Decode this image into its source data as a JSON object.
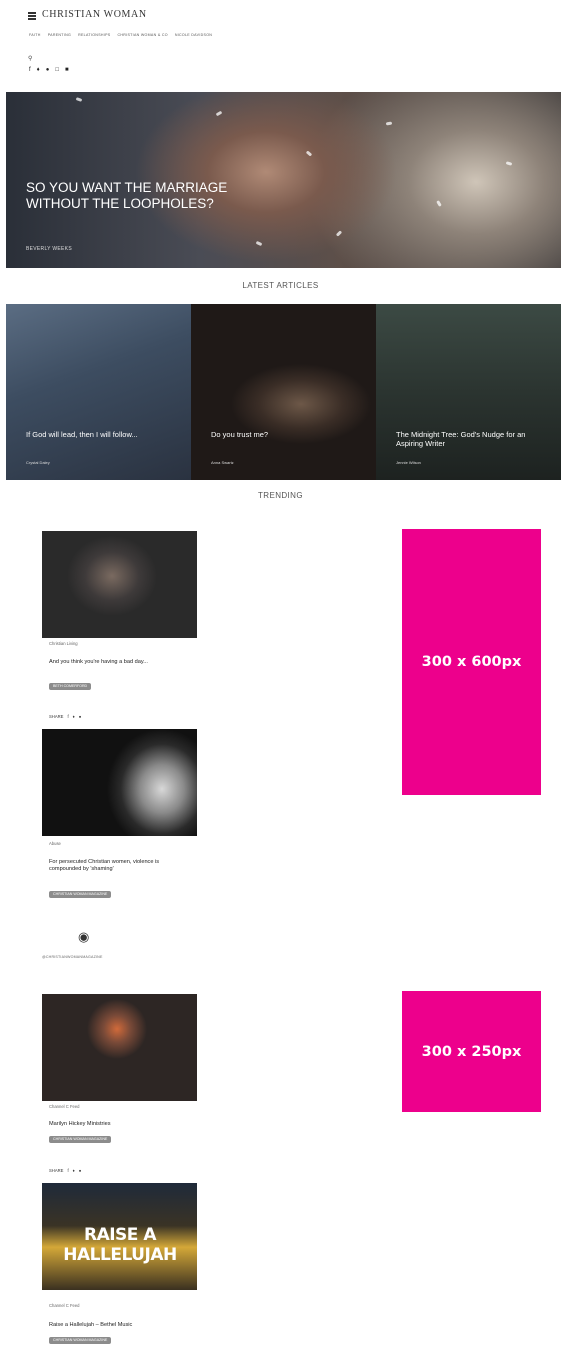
{
  "header": {
    "logo": "CHRISTIAN WOMAN",
    "nav": [
      "FAITH",
      "PARENTING",
      "RELATIONSHIPS",
      "CHRISTIAN WOMAN & CO",
      "NICOLE DAVIDSON"
    ],
    "social_icons": [
      "facebook-icon",
      "twitter-icon",
      "pinterest-icon",
      "instagram-icon",
      "email-icon"
    ]
  },
  "hero": {
    "title": "SO YOU WANT THE MARRIAGE WITHOUT THE LOOPHOLES?",
    "author": "BEVERLY WEEKS"
  },
  "latest": {
    "heading": "LATEST ARTICLES",
    "cards": [
      {
        "title": "If God will lead, then I will follow...",
        "author": "Crystal Daley"
      },
      {
        "title": "Do you trust me?",
        "author": "Anna Swartz"
      },
      {
        "title": "The Midnight Tree: God's Nudge for an Aspiring Writer",
        "author": "Jennie Wilson"
      }
    ]
  },
  "trending": {
    "heading": "TRENDING",
    "share_label": "SHARE",
    "items": [
      {
        "category": "Christian Living",
        "title": "And you think you're having a bad day...",
        "tag": "BETH COMERFORD"
      },
      {
        "category": "Abuse",
        "title": "For persecuted Christian women, violence is compounded by 'shaming'",
        "tag": "CHRISTIAN WOMAN MAGAZINE"
      },
      {
        "category": "Channel C Feed",
        "title": "Marilyn Hickey Ministries",
        "tag": "CHRISTIAN WOMAN MAGAZINE"
      },
      {
        "category": "Channel C Feed",
        "title": "Raise a Hallelujah – Bethel Music",
        "tag": "CHRISTIAN WOMAN MAGAZINE"
      }
    ],
    "video_overlay": "RAISE A HALLELUJAH"
  },
  "instagram": {
    "handle": "@CHRISTIANWOMANMAGAZINE"
  },
  "ads": {
    "large": "300 x 600px",
    "small": "300 x 250px"
  },
  "colors": {
    "ad_pink": "#ed008c",
    "tag_gray": "#8c8c8c"
  }
}
